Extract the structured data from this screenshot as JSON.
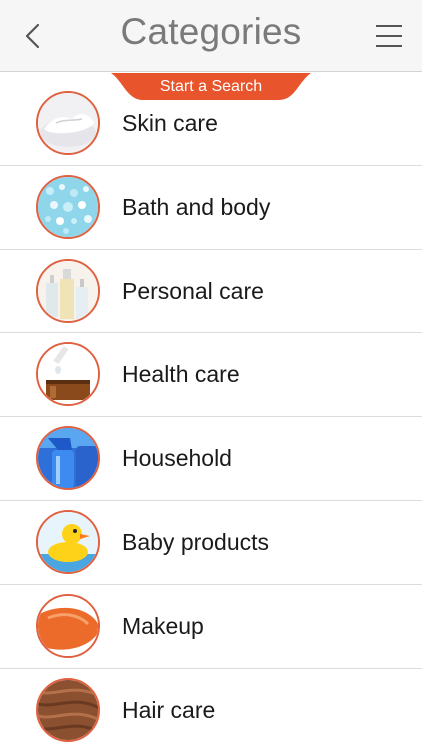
{
  "header": {
    "title": "Categories",
    "back_icon": "chevron-left-icon",
    "menu_icon": "hamburger-menu-icon"
  },
  "search_tab": {
    "label": "Start a Search",
    "color": "#e8542b"
  },
  "colors": {
    "accent": "#e0613f",
    "title": "#7a7a7a",
    "divider": "#dcdcdc"
  },
  "categories": [
    {
      "label": "Skin care",
      "icon": "cream-jar-icon"
    },
    {
      "label": "Bath and body",
      "icon": "bath-salts-icon"
    },
    {
      "label": "Personal care",
      "icon": "bottles-icon"
    },
    {
      "label": "Health care",
      "icon": "dropper-bottle-icon"
    },
    {
      "label": "Household",
      "icon": "spray-bottle-icon"
    },
    {
      "label": "Baby products",
      "icon": "rubber-duck-icon"
    },
    {
      "label": "Makeup",
      "icon": "makeup-swatch-icon"
    },
    {
      "label": "Hair care",
      "icon": "hair-texture-icon"
    }
  ]
}
